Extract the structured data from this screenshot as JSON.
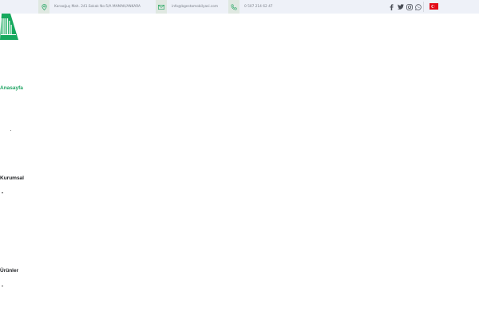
{
  "topbar": {
    "address": "Karaoğuş Mah. 241.Sokak No:5/A MAMAK/ANKARA",
    "email": "info@bgestamobilyasi.com",
    "phone": "0 507 214 62 47",
    "icons": [
      "location-pin-icon",
      "mail-icon",
      "phone-icon"
    ]
  },
  "social": [
    "facebook-icon",
    "twitter-icon",
    "instagram-icon",
    "whatsapp-icon"
  ],
  "language_flag": "turkey-flag-icon",
  "colors": {
    "accent": "#1fa463",
    "topbar_bg": "#eef1f8",
    "icon_box_bg": "#dfe8e1",
    "flag_red": "#e30a17"
  },
  "nav": {
    "items": [
      {
        "label": "Anasayfa",
        "active": true
      },
      {
        "label": "Kurumsal",
        "active": false
      },
      {
        "label": "Ürünler",
        "active": false
      }
    ]
  }
}
